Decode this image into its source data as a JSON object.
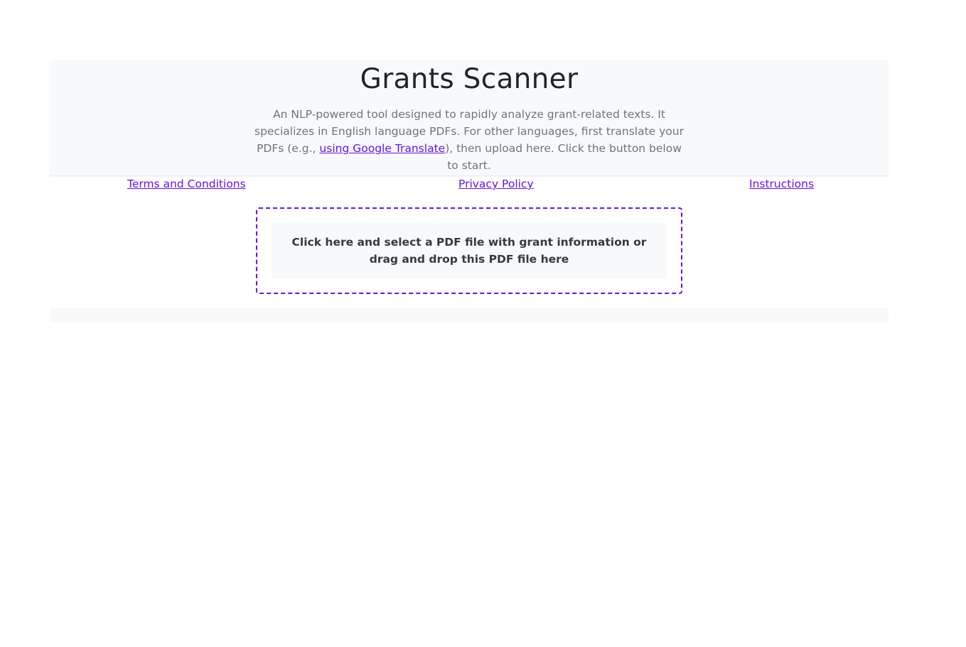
{
  "header": {
    "title": "Grants Scanner",
    "subtitle_before": "An NLP-powered tool designed to rapidly analyze grant-related texts. It specializes in English language PDFs. For other languages, first translate your PDFs (e.g., ",
    "subtitle_link": "using Google Translate",
    "subtitle_after": "), then upload here. Click the button below to start."
  },
  "nav": {
    "terms": "Terms and Conditions",
    "privacy": "Privacy Policy",
    "instructions": "Instructions"
  },
  "upload": {
    "label": "Click here and select a PDF file with grant information or drag and drop this PDF file here"
  },
  "colors": {
    "accent": "#6610f2",
    "panel": "#f8f9fa",
    "title_text": "#212529",
    "muted_text": "#6c757d"
  }
}
